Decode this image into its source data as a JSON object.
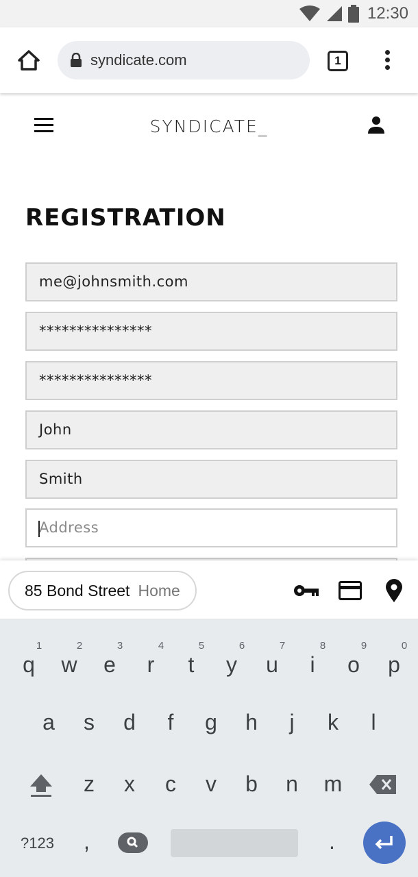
{
  "status_bar": {
    "time": "12:30"
  },
  "browser": {
    "url": "syndicate.com",
    "tab_count": "1"
  },
  "site": {
    "brand": "SYNDICATE_"
  },
  "form": {
    "title": "REGISTRATION",
    "email": "me@johnsmith.com",
    "password": "***************",
    "confirm_password": "***************",
    "first_name": "John",
    "last_name": "Smith",
    "address_placeholder": "Address"
  },
  "autofill": {
    "suggestion_value": "85 Bond Street",
    "suggestion_label": "Home"
  },
  "keyboard": {
    "row1": [
      {
        "hint": "1",
        "char": "q"
      },
      {
        "hint": "2",
        "char": "w"
      },
      {
        "hint": "3",
        "char": "e"
      },
      {
        "hint": "4",
        "char": "r"
      },
      {
        "hint": "5",
        "char": "t"
      },
      {
        "hint": "6",
        "char": "y"
      },
      {
        "hint": "7",
        "char": "u"
      },
      {
        "hint": "8",
        "char": "i"
      },
      {
        "hint": "9",
        "char": "o"
      },
      {
        "hint": "0",
        "char": "p"
      }
    ],
    "row2": [
      "a",
      "s",
      "d",
      "f",
      "g",
      "h",
      "j",
      "k",
      "l"
    ],
    "row3": [
      "z",
      "x",
      "c",
      "v",
      "b",
      "n",
      "m"
    ],
    "symbols_label": "?123",
    "comma": ",",
    "period": "."
  },
  "icons": {
    "status": [
      "wifi-icon",
      "cellular-signal-icon",
      "battery-icon"
    ],
    "toolbar": [
      "home-icon",
      "lock-icon",
      "tab-switcher-icon",
      "more-vert-icon"
    ],
    "header": [
      "hamburger-menu-icon",
      "account-icon"
    ],
    "autofill": [
      "key-icon",
      "credit-card-icon",
      "location-pin-icon"
    ],
    "keyboard": [
      "shift-icon",
      "backspace-icon",
      "search-icon",
      "enter-icon"
    ]
  },
  "colors": {
    "enter_key": "#4a72c4",
    "keyboard_bg": "#e8ebee",
    "field_bg": "#efefef"
  }
}
